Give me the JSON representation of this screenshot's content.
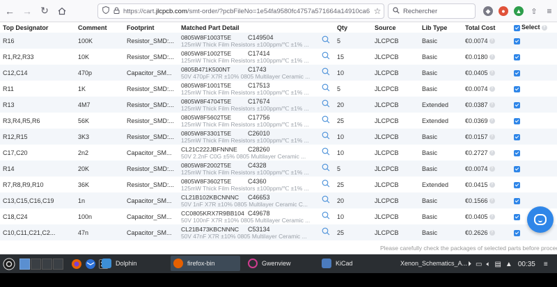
{
  "browser": {
    "url_host": "https://cart.",
    "url_domain": "jlcpcb.com",
    "url_path": "/smt-order/?pcbFileNo=1e54fa9580fc4757a571664a14910ca6",
    "search_placeholder": "Rechercher"
  },
  "table": {
    "headers": {
      "designator": "Top Designator",
      "comment": "Comment",
      "footprint": "Footprint",
      "matched": "Matched Part Detail",
      "qty": "Qty",
      "source": "Source",
      "libtype": "Lib Type",
      "total": "Total Cost",
      "select": "Select"
    },
    "rows": [
      {
        "designator": "R16",
        "comment": "100K",
        "footprint": "Resistor_SMD:...",
        "mpn": "0805W8F1003T5E",
        "lcsc": "C149504",
        "desc": "125mW Thick Film Resistors ±100ppm/℃ ±1% ...",
        "qty": "5",
        "source": "JLCPCB",
        "libtype": "Basic",
        "total": "€0.0074"
      },
      {
        "designator": "R1,R2,R33",
        "comment": "10K",
        "footprint": "Resistor_SMD:...",
        "mpn": "0805W8F1002T5E",
        "lcsc": "C17414",
        "desc": "125mW Thick Film Resistors ±100ppm/℃ ±1% ...",
        "qty": "15",
        "source": "JLCPCB",
        "libtype": "Basic",
        "total": "€0.0180"
      },
      {
        "designator": "C12,C14",
        "comment": "470p",
        "footprint": "Capacitor_SM...",
        "mpn": "0805B471K500NT",
        "lcsc": "C1743",
        "desc": "50V 470pF X7R ±10% 0805 Multilayer Ceramic ...",
        "qty": "10",
        "source": "JLCPCB",
        "libtype": "Basic",
        "total": "€0.0405"
      },
      {
        "designator": "R11",
        "comment": "1K",
        "footprint": "Resistor_SMD:...",
        "mpn": "0805W8F1001T5E",
        "lcsc": "C17513",
        "desc": "125mW Thick Film Resistors ±100ppm/℃ ±1% ...",
        "qty": "5",
        "source": "JLCPCB",
        "libtype": "Basic",
        "total": "€0.0074"
      },
      {
        "designator": "R13",
        "comment": "4M7",
        "footprint": "Resistor_SMD:...",
        "mpn": "0805W8F4704T5E",
        "lcsc": "C17674",
        "desc": "125mW Thick Film Resistors ±100ppm/℃ ±1% ...",
        "qty": "20",
        "source": "JLCPCB",
        "libtype": "Extended",
        "total": "€0.0387"
      },
      {
        "designator": "R3,R4,R5,R6",
        "comment": "56K",
        "footprint": "Resistor_SMD:...",
        "mpn": "0805W8F5602T5E",
        "lcsc": "C17756",
        "desc": "125mW Thick Film Resistors ±100ppm/℃ ±1% ...",
        "qty": "25",
        "source": "JLCPCB",
        "libtype": "Extended",
        "total": "€0.0369"
      },
      {
        "designator": "R12,R15",
        "comment": "3K3",
        "footprint": "Resistor_SMD:...",
        "mpn": "0805W8F3301T5E",
        "lcsc": "C26010",
        "desc": "125mW Thick Film Resistors ±100ppm/℃ ±1% ...",
        "qty": "10",
        "source": "JLCPCB",
        "libtype": "Basic",
        "total": "€0.0157"
      },
      {
        "designator": "C17,C20",
        "comment": "2n2",
        "footprint": "Capacitor_SM...",
        "mpn": "CL21C222JBFNNNE",
        "lcsc": "C28260",
        "desc": "50V 2.2nF C0G ±5% 0805 Multilayer Ceramic ...",
        "qty": "10",
        "source": "JLCPCB",
        "libtype": "Basic",
        "total": "€0.2727"
      },
      {
        "designator": "R14",
        "comment": "20K",
        "footprint": "Resistor_SMD:...",
        "mpn": "0805W8F2002T5E",
        "lcsc": "C4328",
        "desc": "125mW Thick Film Resistors ±100ppm/℃ ±1% ...",
        "qty": "5",
        "source": "JLCPCB",
        "libtype": "Basic",
        "total": "€0.0074"
      },
      {
        "designator": "R7,R8,R9,R10",
        "comment": "36K",
        "footprint": "Resistor_SMD:...",
        "mpn": "0805W8F3602T5E",
        "lcsc": "C4360",
        "desc": "125mW Thick Film Resistors ±100ppm/℃ ±1% ...",
        "qty": "25",
        "source": "JLCPCB",
        "libtype": "Extended",
        "total": "€0.0415"
      },
      {
        "designator": "C13,C15,C16,C19",
        "comment": "1n",
        "footprint": "Capacitor_SM...",
        "mpn": "CL21B102KBCNNNC",
        "lcsc": "C46653",
        "desc": "50V 1nF X7R ±10% 0805 Multilayer Ceramic C...",
        "qty": "20",
        "source": "JLCPCB",
        "libtype": "Basic",
        "total": "€0.1566"
      },
      {
        "designator": "C18,C24",
        "comment": "100n",
        "footprint": "Capacitor_SM...",
        "mpn": "CC0805KRX7R9BB104",
        "lcsc": "C49678",
        "desc": "50V 100nF X7R ±10% 0805 Multilayer Ceramic ...",
        "qty": "10",
        "source": "JLCPCB",
        "libtype": "Basic",
        "total": "€0.0405"
      },
      {
        "designator": "C10,C11,C21,C2...",
        "comment": "47n",
        "footprint": "Capacitor_SM...",
        "mpn": "CL21B473KBCNNNC",
        "lcsc": "C53134",
        "desc": "50V 47nF X7R ±10% 0805 Multilayer Ceramic ...",
        "qty": "25",
        "source": "JLCPCB",
        "libtype": "Basic",
        "total": "€0.2626"
      }
    ]
  },
  "footer_note": "Please carefully check the packages of selected parts before proceeding",
  "taskbar": {
    "tasks": [
      {
        "label": "Dolphin",
        "color": "#3d8fd6"
      },
      {
        "label": "firefox-bin",
        "color": "#e66000"
      },
      {
        "label": "Gwenview",
        "color": "#d13c8f"
      },
      {
        "label": "KiCad",
        "color": "#4b7bbd"
      },
      {
        "label": "Xenon_Schematics_A...",
        "color": "#c0392b"
      }
    ],
    "clock": "00:35"
  },
  "colors": {
    "accent": "#2f86e8",
    "row_alt": "#f3f6fa",
    "taskbar": "#2a2e32"
  }
}
